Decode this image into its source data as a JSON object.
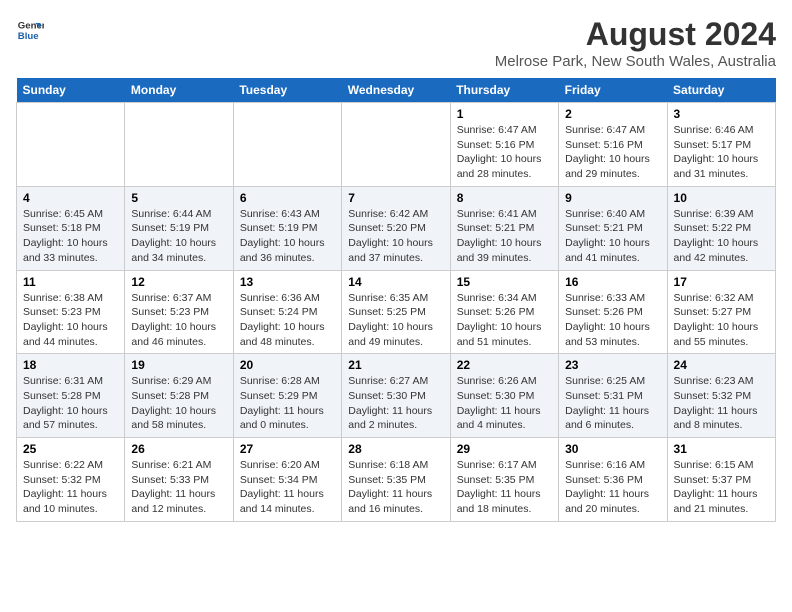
{
  "logo": {
    "line1": "General",
    "line2": "Blue"
  },
  "title": "August 2024",
  "subtitle": "Melrose Park, New South Wales, Australia",
  "days_of_week": [
    "Sunday",
    "Monday",
    "Tuesday",
    "Wednesday",
    "Thursday",
    "Friday",
    "Saturday"
  ],
  "weeks": [
    [
      {
        "day": "",
        "info": ""
      },
      {
        "day": "",
        "info": ""
      },
      {
        "day": "",
        "info": ""
      },
      {
        "day": "",
        "info": ""
      },
      {
        "day": "1",
        "info": "Sunrise: 6:47 AM\nSunset: 5:16 PM\nDaylight: 10 hours\nand 28 minutes."
      },
      {
        "day": "2",
        "info": "Sunrise: 6:47 AM\nSunset: 5:16 PM\nDaylight: 10 hours\nand 29 minutes."
      },
      {
        "day": "3",
        "info": "Sunrise: 6:46 AM\nSunset: 5:17 PM\nDaylight: 10 hours\nand 31 minutes."
      }
    ],
    [
      {
        "day": "4",
        "info": "Sunrise: 6:45 AM\nSunset: 5:18 PM\nDaylight: 10 hours\nand 33 minutes."
      },
      {
        "day": "5",
        "info": "Sunrise: 6:44 AM\nSunset: 5:19 PM\nDaylight: 10 hours\nand 34 minutes."
      },
      {
        "day": "6",
        "info": "Sunrise: 6:43 AM\nSunset: 5:19 PM\nDaylight: 10 hours\nand 36 minutes."
      },
      {
        "day": "7",
        "info": "Sunrise: 6:42 AM\nSunset: 5:20 PM\nDaylight: 10 hours\nand 37 minutes."
      },
      {
        "day": "8",
        "info": "Sunrise: 6:41 AM\nSunset: 5:21 PM\nDaylight: 10 hours\nand 39 minutes."
      },
      {
        "day": "9",
        "info": "Sunrise: 6:40 AM\nSunset: 5:21 PM\nDaylight: 10 hours\nand 41 minutes."
      },
      {
        "day": "10",
        "info": "Sunrise: 6:39 AM\nSunset: 5:22 PM\nDaylight: 10 hours\nand 42 minutes."
      }
    ],
    [
      {
        "day": "11",
        "info": "Sunrise: 6:38 AM\nSunset: 5:23 PM\nDaylight: 10 hours\nand 44 minutes."
      },
      {
        "day": "12",
        "info": "Sunrise: 6:37 AM\nSunset: 5:23 PM\nDaylight: 10 hours\nand 46 minutes."
      },
      {
        "day": "13",
        "info": "Sunrise: 6:36 AM\nSunset: 5:24 PM\nDaylight: 10 hours\nand 48 minutes."
      },
      {
        "day": "14",
        "info": "Sunrise: 6:35 AM\nSunset: 5:25 PM\nDaylight: 10 hours\nand 49 minutes."
      },
      {
        "day": "15",
        "info": "Sunrise: 6:34 AM\nSunset: 5:26 PM\nDaylight: 10 hours\nand 51 minutes."
      },
      {
        "day": "16",
        "info": "Sunrise: 6:33 AM\nSunset: 5:26 PM\nDaylight: 10 hours\nand 53 minutes."
      },
      {
        "day": "17",
        "info": "Sunrise: 6:32 AM\nSunset: 5:27 PM\nDaylight: 10 hours\nand 55 minutes."
      }
    ],
    [
      {
        "day": "18",
        "info": "Sunrise: 6:31 AM\nSunset: 5:28 PM\nDaylight: 10 hours\nand 57 minutes."
      },
      {
        "day": "19",
        "info": "Sunrise: 6:29 AM\nSunset: 5:28 PM\nDaylight: 10 hours\nand 58 minutes."
      },
      {
        "day": "20",
        "info": "Sunrise: 6:28 AM\nSunset: 5:29 PM\nDaylight: 11 hours\nand 0 minutes."
      },
      {
        "day": "21",
        "info": "Sunrise: 6:27 AM\nSunset: 5:30 PM\nDaylight: 11 hours\nand 2 minutes."
      },
      {
        "day": "22",
        "info": "Sunrise: 6:26 AM\nSunset: 5:30 PM\nDaylight: 11 hours\nand 4 minutes."
      },
      {
        "day": "23",
        "info": "Sunrise: 6:25 AM\nSunset: 5:31 PM\nDaylight: 11 hours\nand 6 minutes."
      },
      {
        "day": "24",
        "info": "Sunrise: 6:23 AM\nSunset: 5:32 PM\nDaylight: 11 hours\nand 8 minutes."
      }
    ],
    [
      {
        "day": "25",
        "info": "Sunrise: 6:22 AM\nSunset: 5:32 PM\nDaylight: 11 hours\nand 10 minutes."
      },
      {
        "day": "26",
        "info": "Sunrise: 6:21 AM\nSunset: 5:33 PM\nDaylight: 11 hours\nand 12 minutes."
      },
      {
        "day": "27",
        "info": "Sunrise: 6:20 AM\nSunset: 5:34 PM\nDaylight: 11 hours\nand 14 minutes."
      },
      {
        "day": "28",
        "info": "Sunrise: 6:18 AM\nSunset: 5:35 PM\nDaylight: 11 hours\nand 16 minutes."
      },
      {
        "day": "29",
        "info": "Sunrise: 6:17 AM\nSunset: 5:35 PM\nDaylight: 11 hours\nand 18 minutes."
      },
      {
        "day": "30",
        "info": "Sunrise: 6:16 AM\nSunset: 5:36 PM\nDaylight: 11 hours\nand 20 minutes."
      },
      {
        "day": "31",
        "info": "Sunrise: 6:15 AM\nSunset: 5:37 PM\nDaylight: 11 hours\nand 21 minutes."
      }
    ]
  ]
}
